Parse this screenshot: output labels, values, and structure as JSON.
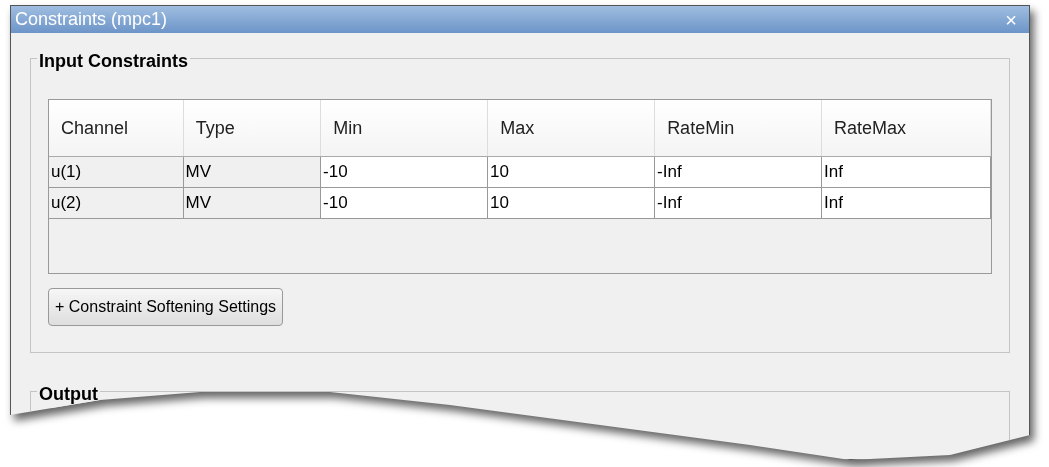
{
  "window": {
    "title": "Constraints (mpc1)",
    "close": "×"
  },
  "input_constraints": {
    "title": "Input Constraints",
    "columns": [
      {
        "label": "Channel",
        "editable": false
      },
      {
        "label": "Type",
        "editable": false
      },
      {
        "label": "Min",
        "editable": true
      },
      {
        "label": "Max",
        "editable": true
      },
      {
        "label": "RateMin",
        "editable": true
      },
      {
        "label": "RateMax",
        "editable": true
      }
    ],
    "rows": [
      [
        "u(1)",
        "MV",
        "-10",
        "10",
        "-Inf",
        "Inf"
      ],
      [
        "u(2)",
        "MV",
        "-10",
        "10",
        "-Inf",
        "Inf"
      ]
    ],
    "button": "+ Constraint Softening Settings"
  },
  "output_constraints": {
    "title": "Output"
  }
}
